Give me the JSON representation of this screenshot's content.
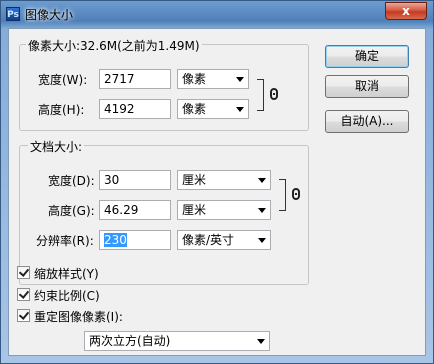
{
  "window": {
    "title": "图像大小",
    "close_glyph": "x"
  },
  "buttons": {
    "ok": "确定",
    "cancel": "取消",
    "auto": "自动(A)..."
  },
  "pixel_dimensions": {
    "legend": "像素大小:32.6M(之前为1.49M)",
    "width": {
      "label": "宽度(W):",
      "value": "2717",
      "unit": "像素"
    },
    "height": {
      "label": "高度(H):",
      "value": "4192",
      "unit": "像素"
    }
  },
  "document_size": {
    "legend": "文档大小:",
    "width": {
      "label": "宽度(D):",
      "value": "30",
      "unit": "厘米"
    },
    "height": {
      "label": "高度(G):",
      "value": "46.29",
      "unit": "厘米"
    },
    "resolution": {
      "label": "分辨率(R):",
      "value": "230",
      "unit": "像素/英寸"
    }
  },
  "options": {
    "scale_styles": {
      "label": "缩放样式(Y)",
      "checked": true
    },
    "constrain": {
      "label": "约束比例(C)",
      "checked": true
    },
    "resample": {
      "label": "重定图像像素(I):",
      "checked": true
    },
    "resample_method": "两次立方(自动)"
  },
  "icons": {
    "title": "photoshop-icon",
    "chain": "link-chain-icon",
    "dropdown": "chevron-down-icon"
  }
}
